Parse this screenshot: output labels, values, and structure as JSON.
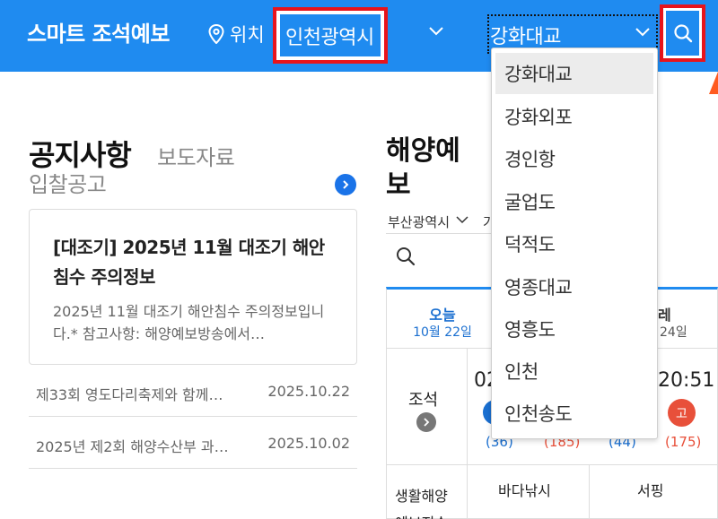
{
  "header": {
    "app_title": "스마트 조석예보",
    "location_label": "위치",
    "region_value": "인천광역시",
    "station_value": "강화대교"
  },
  "notice": {
    "title": "공지사항",
    "tab_press": "보도자료",
    "tab_bid": "입찰공고",
    "card_title": "[대조기] 2025년 11월 대조기 해안침수 주의정보",
    "card_body": "2025년 11월 대조기 해안침수 주의정보입니다.* 참고사항: 해양예보방송에서…",
    "rows": [
      {
        "text": "제33회 영도다리축제와 함께…",
        "date": "2025.10.22"
      },
      {
        "text": "2025년 제2회 해양수산부 과…",
        "date": "2025.10.02"
      }
    ]
  },
  "ocean": {
    "title": "해양예보",
    "area_select": "부산광역시",
    "area_select2": "가",
    "today_label": "오늘",
    "today_date": "10월 22일",
    "later_label": "레",
    "later_date": "24일",
    "tide_label": "조석",
    "time_a": "02",
    "time_b": "20:51",
    "high_badge": "고",
    "val_a": "(36)",
    "val_b": "(185)",
    "val_c": "(44)",
    "val_d": "(175)",
    "life_label": "생활해양",
    "life_label2": "예보지수",
    "fishing": "바다낚시",
    "surfing": "서핑"
  },
  "dropdown": {
    "items": [
      "강화대교",
      "강화외포",
      "경인항",
      "굴업도",
      "덕적도",
      "영종대교",
      "영흥도",
      "인천",
      "인천송도"
    ],
    "selected_index": 0
  },
  "colors": {
    "header_bg": "#1f8bf0",
    "highlight_border": "#e8141b",
    "accent_blue": "#1a6fd0",
    "accent_red": "#e8503a"
  }
}
